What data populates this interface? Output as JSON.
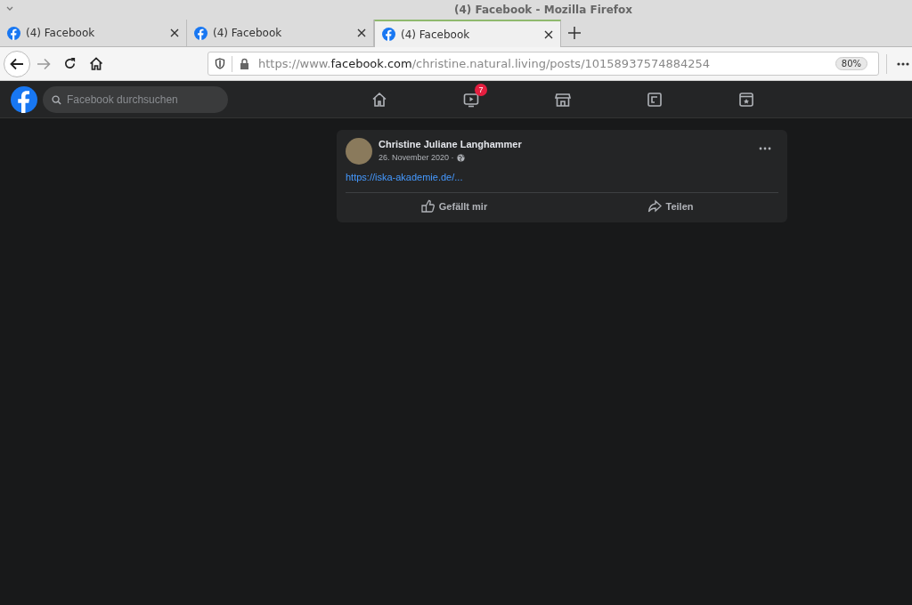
{
  "window": {
    "title": "(4) Facebook - Mozilla Firefox"
  },
  "tabs": [
    {
      "label": "(4) Facebook",
      "selected": false
    },
    {
      "label": "(4) Facebook",
      "selected": false
    },
    {
      "label": "(4) Facebook",
      "selected": true
    }
  ],
  "address_bar": {
    "url_prefix": "https://www.",
    "url_domain": "facebook.com",
    "url_path": "/christine.natural.living/posts/10158937574884254",
    "zoom": "80%"
  },
  "facebook_header": {
    "search": {
      "placeholder": "Facebook durchsuchen"
    },
    "nav": [
      {
        "kind": "home"
      },
      {
        "kind": "watch",
        "badge": "7"
      },
      {
        "kind": "marketplace"
      },
      {
        "kind": "groups"
      },
      {
        "kind": "gaming"
      }
    ]
  },
  "post": {
    "author": "Christine Juliane Langhammer",
    "date": "26. November 2020 ·",
    "link": "https://iska-akademie.de/...",
    "actions": [
      {
        "kind": "like",
        "label": "Gefällt mir"
      },
      {
        "kind": "share",
        "label": "Teilen"
      }
    ]
  }
}
